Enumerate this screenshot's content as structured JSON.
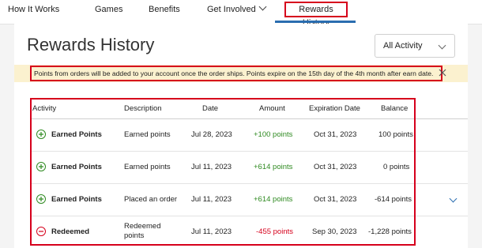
{
  "nav": {
    "items": [
      "How It Works",
      "Games",
      "Benefits",
      "Get Involved"
    ],
    "active": "Rewards History"
  },
  "page": {
    "title": "Rewards History",
    "filter_value": "All Activity"
  },
  "notice": {
    "text": "Points from orders will be added to your account once the order ships. Points expire on the 15th day of the 4th month after earn date."
  },
  "table": {
    "headers": [
      "Activity",
      "Description",
      "Date",
      "Amount",
      "Expiration Date",
      "Balance"
    ],
    "rows": [
      {
        "activity": "Earned Points",
        "description": "Earned points",
        "date": "Jul 28, 2023",
        "amount": "+100 points",
        "expiration": "Oct 31, 2023",
        "balance": "100 points",
        "type": "earned"
      },
      {
        "activity": "Earned Points",
        "description": "Earned points",
        "date": "Jul 11, 2023",
        "amount": "+614 points",
        "expiration": "Oct 31, 2023",
        "balance": "0 points",
        "type": "earned"
      },
      {
        "activity": "Earned Points",
        "description": "Placed an order",
        "date": "Jul 11, 2023",
        "amount": "+614 points",
        "expiration": "Oct 31, 2023",
        "balance": "-614 points",
        "type": "earned"
      },
      {
        "activity": "Redeemed",
        "description": "Redeemed points",
        "date": "Jul 11, 2023",
        "amount": "-455 points",
        "expiration": "Sep 30, 2023",
        "balance": "-1,228 points",
        "type": "redeemed"
      }
    ]
  },
  "colors": {
    "accent": "#2a6db0",
    "positive": "#2f8a21",
    "negative": "#d6001c",
    "highlight_border": "#d6001c",
    "notice_bg": "#fbf1cf"
  }
}
